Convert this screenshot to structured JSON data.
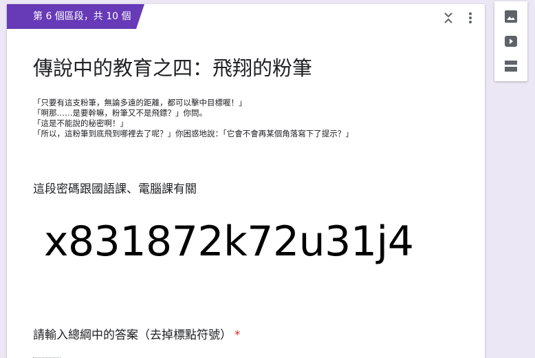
{
  "section": {
    "badge": "第 6 個區段，共 10 個"
  },
  "form": {
    "title": "傳說中的教育之四：飛翔的粉筆",
    "description": [
      "「只要有這支粉筆，無論多遠的距離，都可以擊中目標喔！」",
      "「啊那……是要幹嘛，粉筆又不是飛鏢？」你問。",
      "「這是不能說的秘密啊！」",
      "「所以，這粉筆到底飛到哪裡去了呢？」你困惑地說：「它會不會再某個角落寫下了提示？」"
    ],
    "hint": "這段密碼跟國語課、電腦課有關",
    "code": "x831872k72u31j4",
    "question": "請輸入總綱中的答案（去掉標點符號）",
    "required_mark": "*"
  },
  "icons": {
    "collapse": "collapse-icon",
    "more": "more-vert-icon",
    "image": "image-icon",
    "video": "video-icon",
    "section": "section-icon"
  },
  "colors": {
    "accent": "#673ab7",
    "background": "#ece7f4",
    "required": "#d93025"
  }
}
